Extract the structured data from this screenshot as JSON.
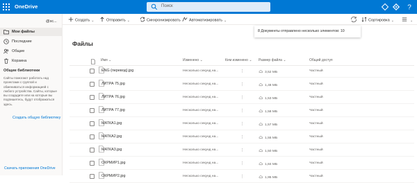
{
  "app": {
    "brand": "OneDrive"
  },
  "search": {
    "placeholder": "Поиск"
  },
  "user": {
    "name": "@sc..."
  },
  "nav": {
    "items": [
      {
        "label": "Мои файлы",
        "icon": "folder-icon",
        "active": true
      },
      {
        "label": "Последние",
        "icon": "clock-icon",
        "active": false
      },
      {
        "label": "Общие",
        "icon": "people-icon",
        "active": false
      },
      {
        "label": "Корзина",
        "icon": "trash-icon",
        "active": false
      }
    ],
    "shared_heading": "Общие библиотеки",
    "shared_description": "Сайты помогают работать над проектами с группой и обмениваться информацией с любого устройства. Сайты, которые вы создадите или на которые вы подпишетесь, будут отображаться здесь.",
    "create_library": "Создать общую библиотеку",
    "get_apps": "Скачать приложения OneDrive"
  },
  "commands": {
    "create": "Создать",
    "send": "Отправить",
    "sync": "Синхронизировать",
    "automate": "Автоматизировать",
    "sort": "Сортировка"
  },
  "notification": "8 Документы отправлено несколько элементов: 10",
  "main": {
    "title": "Файлы",
    "columns": {
      "name": "Имя",
      "modified": "Изменено",
      "modified_by": "Кем изменено",
      "size": "Размер файла",
      "sharing": "Общий доступ"
    },
    "files": [
      {
        "name": "ENG (перевод).jpg",
        "modified": "Несколько секунд на...",
        "size": "3,52 МБ",
        "sharing": "Частный"
      },
      {
        "name": "ЛИТРА 75.jpg",
        "modified": "Несколько секунд на...",
        "size": "1,48 МБ",
        "sharing": "Частный"
      },
      {
        "name": "ЛИТРА 76.jpg",
        "modified": "Несколько секунд на...",
        "size": "1,53 МБ",
        "sharing": "Частный"
      },
      {
        "name": "ЛИТРА 77.jpg",
        "modified": "Несколько секунд на...",
        "size": "1,58 МБ",
        "sharing": "Частный"
      },
      {
        "name": "МАТКА1.jpg",
        "modified": "Несколько секунд на...",
        "size": "1,57 МБ",
        "sharing": "Частный"
      },
      {
        "name": "МАТКА2.jpg",
        "modified": "Несколько секунд на...",
        "size": "1,55 МБ",
        "sharing": "Частный"
      },
      {
        "name": "МАТКА3.jpg",
        "modified": "Несколько секунд на...",
        "size": "1,50 МБ",
        "sharing": "Частный"
      },
      {
        "name": "ОКРМИР1.jpg",
        "modified": "Несколько секунд на...",
        "size": "1,84 МБ",
        "sharing": "Частный"
      },
      {
        "name": "ОКРМИР2.jpg",
        "modified": "Несколько секунд на...",
        "size": "1,95 МБ",
        "sharing": "Частный"
      }
    ]
  },
  "colors": {
    "accent": "#0078d4",
    "nav_bg": "#faf9f8",
    "active_item": "#edebe9"
  }
}
